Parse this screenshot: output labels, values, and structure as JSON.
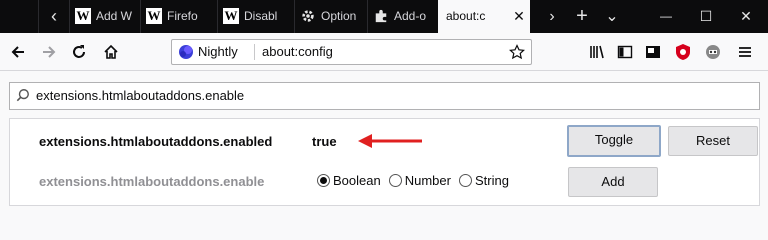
{
  "tabbar": {
    "tabs": [
      {
        "label": "Add W",
        "icon": "wikipedia-icon"
      },
      {
        "label": "Firefo",
        "icon": "wikipedia-icon"
      },
      {
        "label": "Disabl",
        "icon": "wikipedia-icon"
      },
      {
        "label": "Option",
        "icon": "gear-icon"
      },
      {
        "label": "Add-o",
        "icon": "puzzle-icon"
      },
      {
        "label": "about:c",
        "icon": ""
      }
    ],
    "new_tab": "+",
    "list_tabs": "⌄",
    "minimize": "—",
    "maximize": "☐",
    "close": "✕"
  },
  "navbar": {
    "identity": "Nightly",
    "url": "about:config"
  },
  "search": {
    "value": "extensions.htmlaboutaddons.enable"
  },
  "prefs": [
    {
      "name": "extensions.htmlaboutaddons.enabled",
      "value": "true",
      "buttons": [
        "Toggle",
        "Reset"
      ]
    },
    {
      "name": "extensions.htmlaboutaddons.enable",
      "types": [
        "Boolean",
        "Number",
        "String"
      ],
      "selected_type": "Boolean",
      "button": "Add"
    }
  ],
  "colors": {
    "arrow": "#e02020",
    "tabbar": "#0c0c0d",
    "accent": "#8ea7c8"
  }
}
